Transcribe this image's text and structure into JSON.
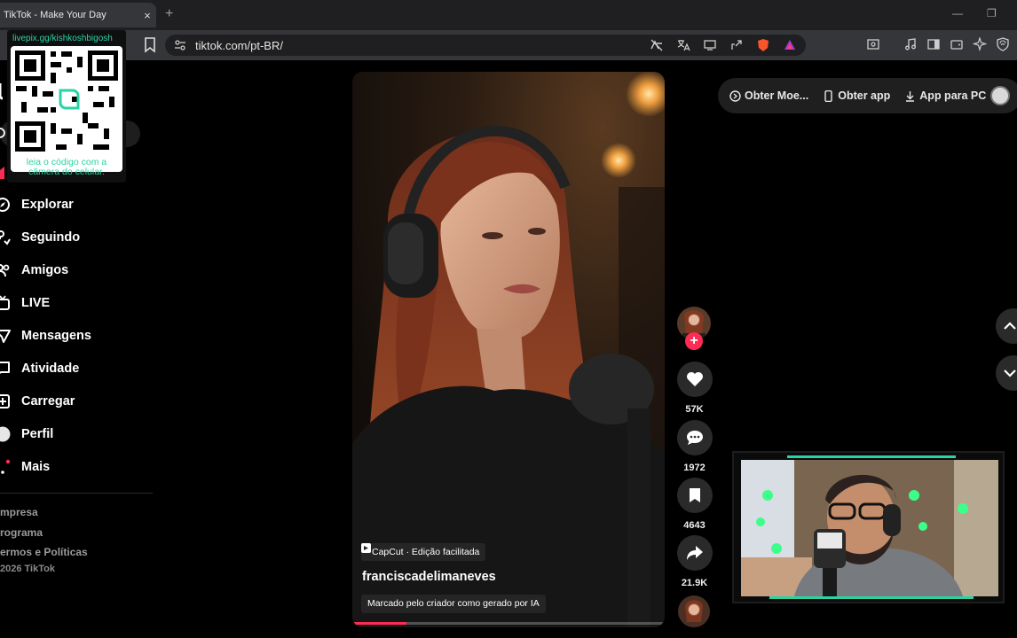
{
  "browser": {
    "tab_title": "TikTok - Make Your Day",
    "tab_close": "×",
    "new_tab": "+",
    "minimize": "—",
    "restore": "❐",
    "url": "tiktok.com/pt-BR/"
  },
  "qr_overlay": {
    "url": "livepix.gg/kishkoshbigosh",
    "caption_line1": "leia o código com a",
    "caption_line2": "câmera do celular."
  },
  "sidebar": {
    "items": [
      {
        "label": "Explorar",
        "icon": "compass-icon"
      },
      {
        "label": "Seguindo",
        "icon": "following-icon"
      },
      {
        "label": "Amigos",
        "icon": "friends-icon"
      },
      {
        "label": "LIVE",
        "icon": "live-icon"
      },
      {
        "label": "Mensagens",
        "icon": "messages-icon"
      },
      {
        "label": "Atividade",
        "icon": "activity-icon"
      },
      {
        "label": "Carregar",
        "icon": "upload-icon"
      },
      {
        "label": "Perfil",
        "icon": "profile-icon"
      },
      {
        "label": "Mais",
        "icon": "more-icon"
      }
    ],
    "footer": [
      "mpresa",
      "rograma",
      "ermos e Políticas"
    ],
    "copyright": "2026 TikTok"
  },
  "video": {
    "capcut_label": "CapCut · Edição facilitada",
    "author": "franciscadelimaneves",
    "ai_label": "Marcado pelo criador como gerado por IA",
    "progress_fraction": 0.17
  },
  "actions": {
    "likes": "57K",
    "comments": "1972",
    "saves": "4643",
    "shares": "21.9K"
  },
  "topbar": {
    "coins": "Obter Moe...",
    "get_app": "Obter app",
    "pc_app": "App para PC"
  },
  "colors": {
    "accent": "#fe2c55",
    "overlay_teal": "#2ad3a3",
    "background": "#000000"
  }
}
